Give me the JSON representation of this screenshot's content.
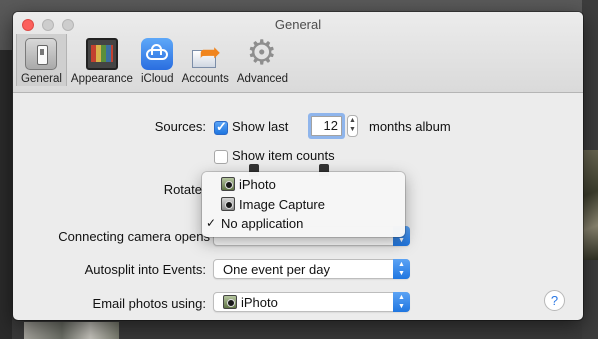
{
  "window": {
    "title": "General"
  },
  "toolbar": {
    "items": [
      {
        "label": "General",
        "icon": "general-switch-icon",
        "selected": true
      },
      {
        "label": "Appearance",
        "icon": "appearance-icon",
        "selected": false
      },
      {
        "label": "iCloud",
        "icon": "icloud-icon",
        "selected": false
      },
      {
        "label": "Accounts",
        "icon": "accounts-icon",
        "selected": false
      },
      {
        "label": "Advanced",
        "icon": "gear-icon",
        "selected": false
      }
    ]
  },
  "sources": {
    "label": "Sources:",
    "show_last_label": "Show last",
    "show_last_checked": true,
    "months_value": "12",
    "months_suffix": "months album",
    "show_item_counts_label": "Show item counts",
    "show_item_counts_checked": false
  },
  "rotate": {
    "label": "Rotate"
  },
  "camera": {
    "label": "Connecting camera opens",
    "selected": "No application"
  },
  "autosplit": {
    "label": "Autosplit into Events:",
    "value": "One event per day"
  },
  "email": {
    "label": "Email photos using:",
    "value": "iPhoto"
  },
  "help": {
    "glyph": "?"
  },
  "camera_menu": {
    "items": [
      {
        "label": "iPhoto",
        "checked": false,
        "icon": "iphoto-icon"
      },
      {
        "label": "Image Capture",
        "checked": false,
        "icon": "image-capture-icon"
      },
      {
        "label": "No application",
        "checked": true,
        "check_glyph": "✓"
      }
    ]
  },
  "colors": {
    "accent": "#1f76e0",
    "close": "#fc605c"
  }
}
